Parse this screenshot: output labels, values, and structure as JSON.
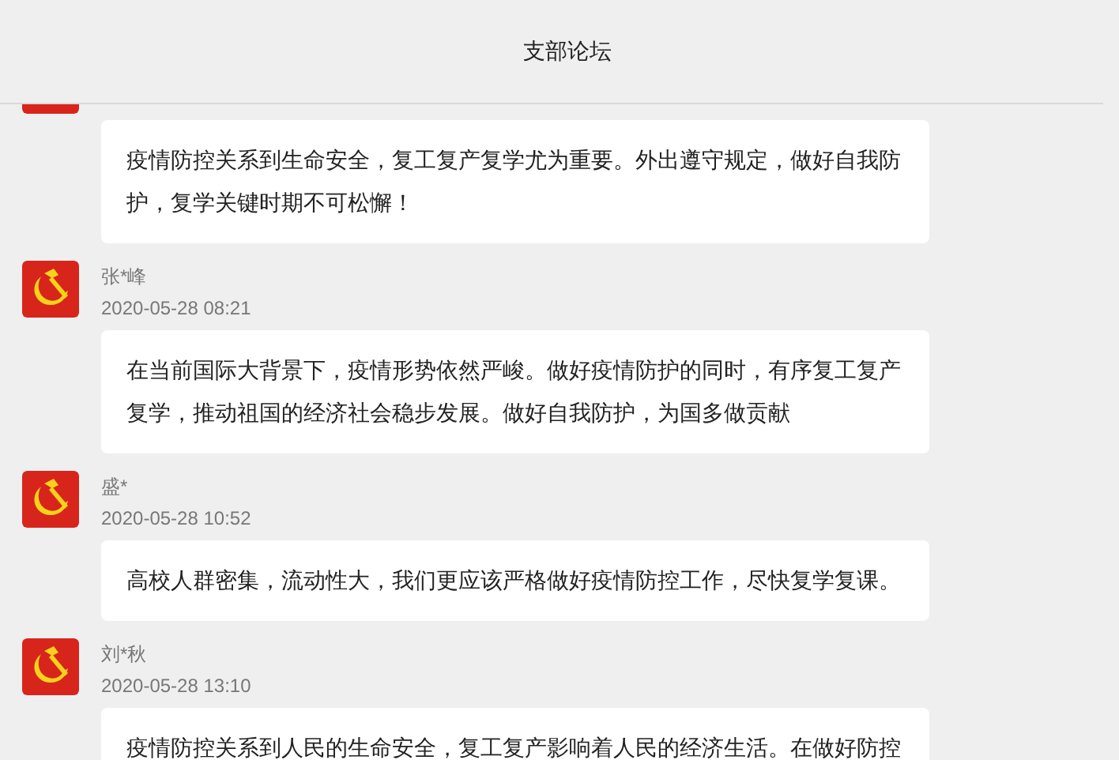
{
  "header": {
    "title": "支部论坛"
  },
  "posts": [
    {
      "body": "疫情防控关系到生命安全，复工复产复学尤为重要。外出遵守规定，做好自我防护，复学关键时期不可松懈！"
    },
    {
      "author": "张*峰",
      "time": "2020-05-28 08:21",
      "body": "在当前国际大背景下，疫情形势依然严峻。做好疫情防护的同时，有序复工复产复学，推动祖国的经济社会稳步发展。做好自我防护，为国多做贡献"
    },
    {
      "author": "盛*",
      "time": "2020-05-28 10:52",
      "body": "高校人群密集，流动性大，我们更应该严格做好疫情防控工作，尽快复学复课。"
    },
    {
      "author": "刘*秋",
      "time": "2020-05-28 13:10",
      "body": "疫情防控关系到人民的生命安全，复工复产影响着人民的经济生活。在做好防控"
    }
  ]
}
